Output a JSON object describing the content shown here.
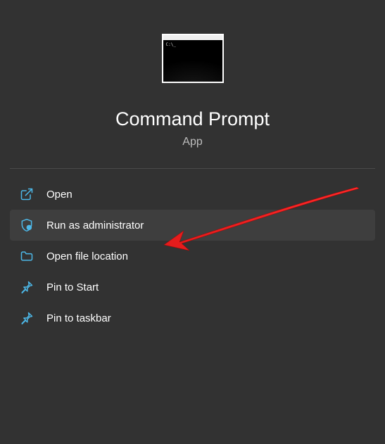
{
  "header": {
    "title": "Command Prompt",
    "subtitle": "App"
  },
  "menu": {
    "items": [
      {
        "icon": "external-link-icon",
        "label": "Open"
      },
      {
        "icon": "shield-icon",
        "label": "Run as administrator"
      },
      {
        "icon": "folder-icon",
        "label": "Open file location"
      },
      {
        "icon": "pin-icon",
        "label": "Pin to Start"
      },
      {
        "icon": "pin-icon",
        "label": "Pin to taskbar"
      }
    ],
    "hovered_index": 1
  },
  "colors": {
    "accent": "#4db8e8",
    "background": "#323232",
    "hover": "#3e3e3e",
    "annotation": "#e31b1b"
  }
}
